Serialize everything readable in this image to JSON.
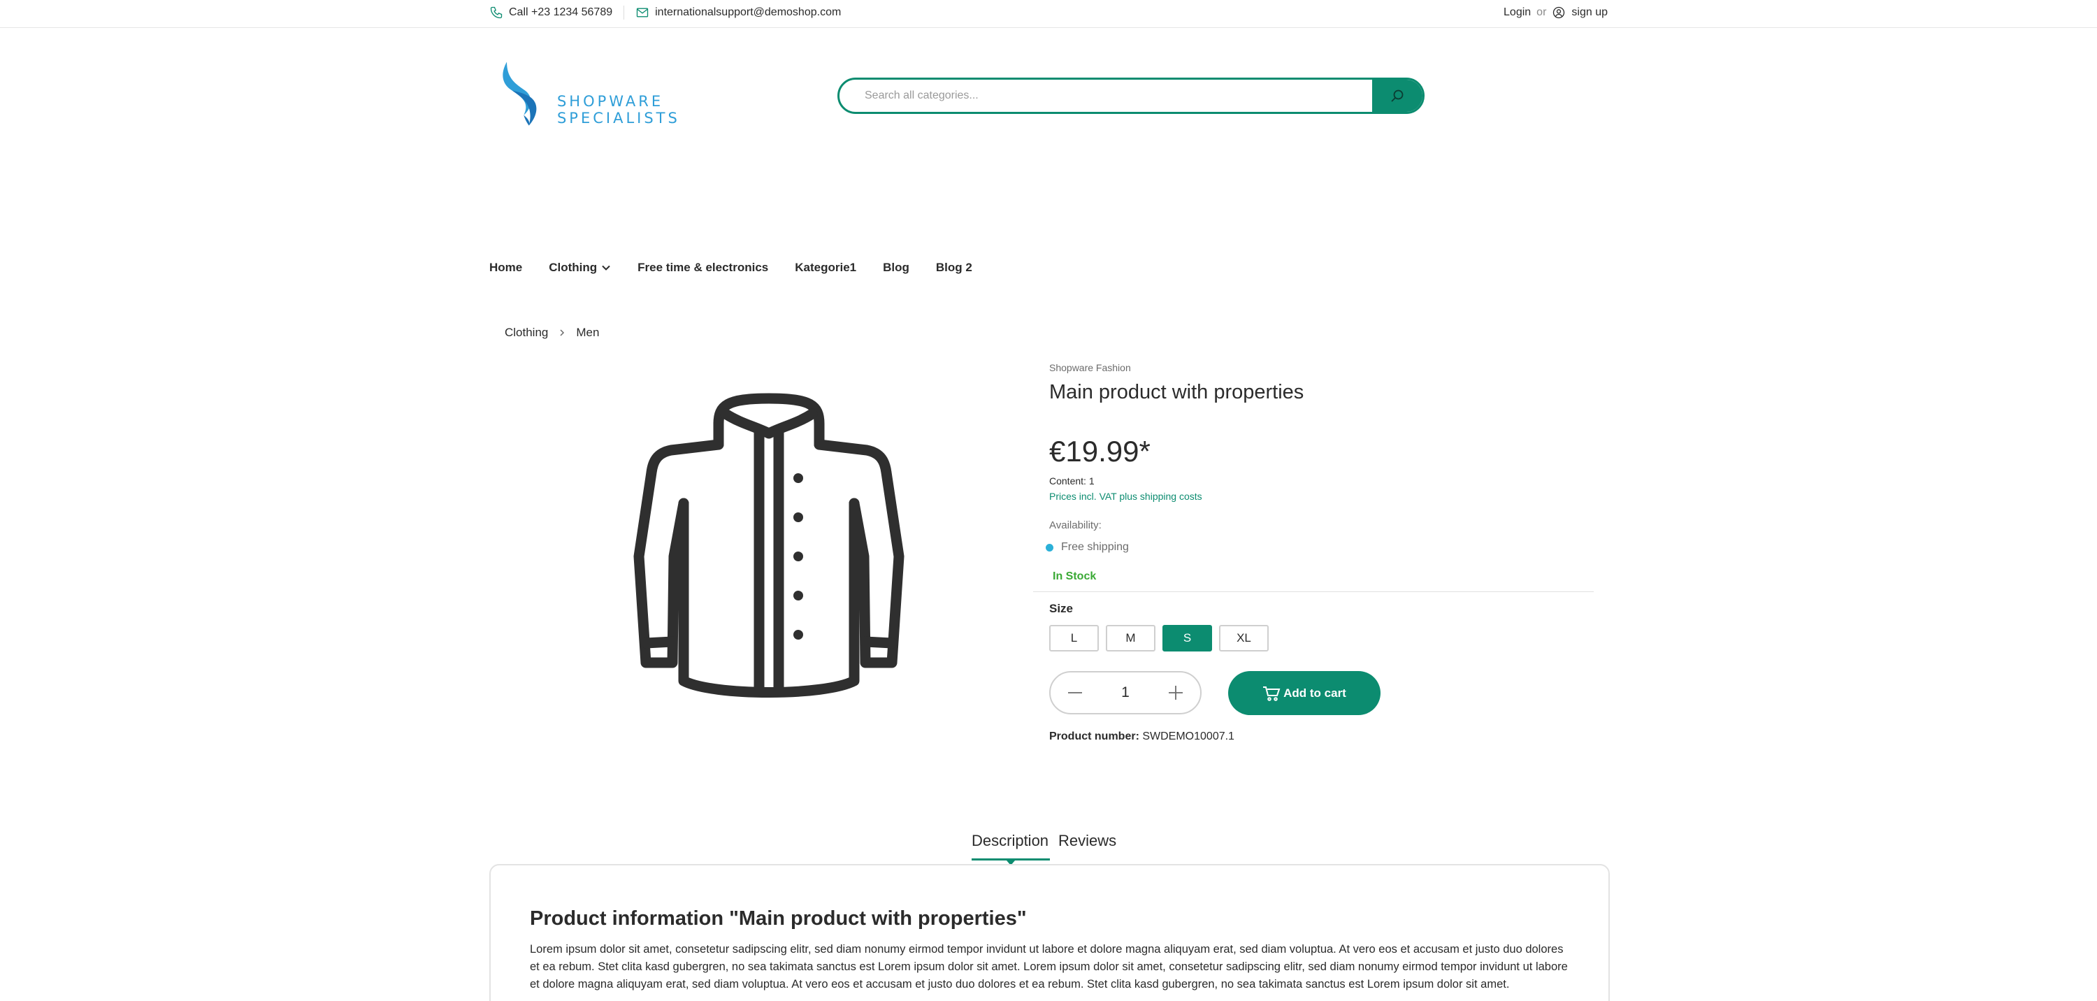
{
  "topbar": {
    "phone": "Call +23 1234 56789",
    "email": "internationalsupport@demoshop.com",
    "login": "Login",
    "or": "or",
    "signup": "sign up"
  },
  "header": {
    "logo_text": "SHOPWARE SPECIALISTS",
    "search_placeholder": "Search all categories..."
  },
  "nav": {
    "items": [
      "Home",
      "Clothing",
      "Free time & electronics",
      "Kategorie1",
      "Blog",
      "Blog 2"
    ]
  },
  "breadcrumb": [
    "Clothing",
    "Men"
  ],
  "product": {
    "manufacturer": "Shopware Fashion",
    "name": "Main product with properties",
    "price": "€19.99*",
    "content": "Content: 1",
    "vat_note": "Prices incl. VAT plus shipping costs",
    "availability_label": "Availability:",
    "shipping": "Free shipping",
    "stock": "In Stock",
    "size_label": "Size",
    "sizes": [
      "L",
      "M",
      "S",
      "XL"
    ],
    "selected_size": "S",
    "quantity": "1",
    "add_to_cart": "Add to cart",
    "number_label": "Product number:",
    "number": "SWDEMO10007.1"
  },
  "tabs": [
    "Description",
    "Reviews"
  ],
  "description": {
    "title": "Product information \"Main product with properties\"",
    "body": "Lorem ipsum dolor sit amet, consetetur sadipscing elitr, sed diam nonumy eirmod tempor invidunt ut labore et dolore magna aliquyam erat, sed diam voluptua. At vero eos et accusam et justo duo dolores et ea rebum. Stet clita kasd gubergren, no sea takimata sanctus est Lorem ipsum dolor sit amet. Lorem ipsum dolor sit amet, consetetur sadipscing elitr, sed diam nonumy eirmod tempor invidunt ut labore et dolore magna aliquyam erat, sed diam voluptua. At vero eos et accusam et justo duo dolores et ea rebum. Stet clita kasd gubergren, no sea takimata sanctus est Lorem ipsum dolor sit amet."
  },
  "colors": {
    "accent": "#0c8c70",
    "logo_blue": "#2f9ed8",
    "stock_green": "#3aa935",
    "shipping_dot": "#2bb0d8"
  }
}
